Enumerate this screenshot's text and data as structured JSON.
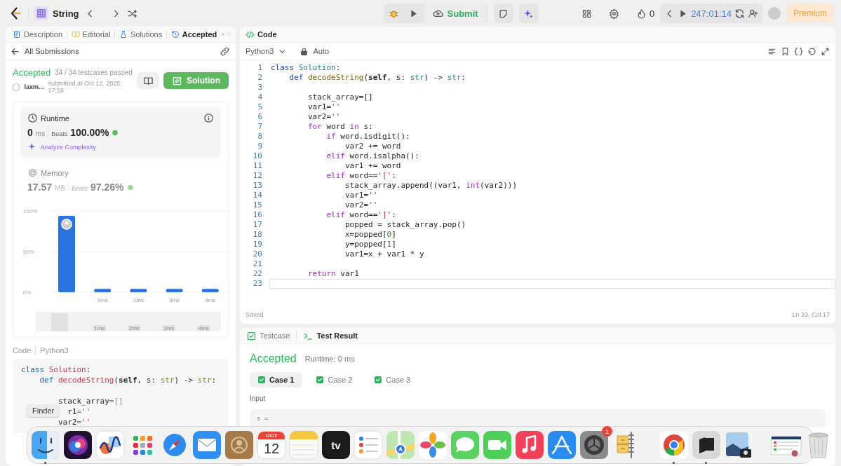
{
  "top_bar": {
    "problem_list": "String",
    "submit": "Submit",
    "streak": "0",
    "timer": "247:01:14",
    "premium": "Premium"
  },
  "left_panel": {
    "tabs": [
      {
        "label": "Description",
        "selected": false
      },
      {
        "label": "Editorial",
        "selected": false
      },
      {
        "label": "Solutions",
        "selected": false
      },
      {
        "label": "Accepted",
        "selected": true
      }
    ],
    "back_link": "All Submissions",
    "submission": {
      "status": "Accepted",
      "passed": "34 / 34 testcases passed",
      "user": "laxm...",
      "submitted": "submitted at Oct 12, 2025 17:59",
      "solution_button": "Solution"
    },
    "stats": [
      {
        "kind": "runtime",
        "label": "Runtime",
        "value": "0",
        "unit": "ms",
        "beats_label": "Beats",
        "beats": "100.00%",
        "selected": true,
        "link": "Analyze Complexity"
      },
      {
        "kind": "memory",
        "label": "Memory",
        "value": "17.57",
        "unit": "MB",
        "beats_label": "Beats",
        "beats": "97.26%",
        "selected": false
      }
    ],
    "chart_data": {
      "type": "bar",
      "categories": [
        null,
        "1ms",
        "2ms",
        "3ms",
        "4ms"
      ],
      "values": [
        94,
        4,
        4,
        4,
        4
      ],
      "ylim": [
        0,
        100
      ],
      "yticks": [
        {
          "value": 0,
          "label": "0%"
        },
        {
          "value": 50,
          "label": "50%"
        },
        {
          "value": 100,
          "label": "100%"
        }
      ]
    },
    "navigator": {
      "labels": [
        "1ms",
        "2ms",
        "3ms",
        "4ms"
      ]
    },
    "code_label": "Code",
    "code_language": "Python3",
    "code_lines": [
      {
        "kind": "code",
        "code": "class Solution:"
      },
      {
        "kind": "code",
        "code": "    def decodeString(self, s: str) -> str:"
      },
      {
        "kind": "blank"
      },
      {
        "kind": "code",
        "code": "        stack_array=[]"
      },
      {
        "kind": "code",
        "code": "          r1=''"
      },
      {
        "kind": "code",
        "code": "        var2=''"
      }
    ]
  },
  "editor": {
    "title": "Code",
    "language": "Python3",
    "mode": "Auto",
    "lines": [
      {
        "n": "1",
        "code": "class Solution:",
        "current": false
      },
      {
        "n": "2",
        "code": "    def decodeString(self, s: str) -> str:",
        "current": false
      },
      {
        "n": "3",
        "current": false
      },
      {
        "n": "4",
        "code": "        stack_array=[]",
        "current": false
      },
      {
        "n": "5",
        "code": "        var1=''",
        "current": false
      },
      {
        "n": "6",
        "code": "        var2=''",
        "current": false
      },
      {
        "n": "7",
        "code": "        for word in s:",
        "current": false
      },
      {
        "n": "8",
        "code": "            if word.isdigit():",
        "current": false
      },
      {
        "n": "9",
        "code": "                var2 += word",
        "current": false
      },
      {
        "n": "10",
        "code": "            elif word.isalpha():",
        "current": false
      },
      {
        "n": "11",
        "code": "                var1 += word",
        "current": false
      },
      {
        "n": "12",
        "code": "            elif word=='[':",
        "current": false
      },
      {
        "n": "13",
        "code": "                stack_array.append((var1, int(var2)))",
        "current": false
      },
      {
        "n": "14",
        "code": "                var1=''",
        "current": false
      },
      {
        "n": "15",
        "code": "                var2=''",
        "current": false
      },
      {
        "n": "16",
        "code": "            elif word==']':",
        "current": false
      },
      {
        "n": "17",
        "code": "                popped = stack_array.pop()",
        "current": false
      },
      {
        "n": "18",
        "code": "                x=popped[0]",
        "current": false
      },
      {
        "n": "19",
        "code": "                y=popped[1]",
        "current": false
      },
      {
        "n": "20",
        "code": "                var1=x + var1 * y",
        "current": false
      },
      {
        "n": "21",
        "current": false
      },
      {
        "n": "22",
        "code": "        return var1",
        "current": false
      },
      {
        "n": "23",
        "current": true
      }
    ],
    "status": "Saved",
    "position": "Ln 23, Col 17"
  },
  "result_panel": {
    "tabs": [
      {
        "label": "Testcase",
        "selected": false
      },
      {
        "label": "Test Result",
        "selected": true
      }
    ],
    "status": "Accepted",
    "runtime": "Runtime: 0 ms",
    "cases": [
      {
        "label": "Case 1",
        "selected": true
      },
      {
        "label": "Case 2",
        "selected": false
      },
      {
        "label": "Case 3",
        "selected": false
      }
    ],
    "input_label": "Input",
    "input_value": "s ="
  },
  "tooltip": "Finder",
  "dock": [
    {
      "kind": "finder",
      "running": true
    },
    {
      "kind": "siri",
      "running": false
    },
    {
      "kind": "freeform",
      "running": false
    },
    {
      "kind": "launchpad",
      "running": false
    },
    {
      "kind": "safari",
      "running": false
    },
    {
      "kind": "mail",
      "running": false
    },
    {
      "kind": "contacts",
      "running": false
    },
    {
      "kind": "calendar",
      "month": "OCT",
      "day": "12",
      "running": false
    },
    {
      "kind": "notes",
      "running": false
    },
    {
      "kind": "tv",
      "label": "tv",
      "running": false
    },
    {
      "kind": "reminders",
      "running": false
    },
    {
      "kind": "maps",
      "running": false
    },
    {
      "kind": "photos",
      "running": false
    },
    {
      "kind": "messages",
      "running": false
    },
    {
      "kind": "facetime",
      "running": false
    },
    {
      "kind": "music",
      "running": false
    },
    {
      "kind": "appstore",
      "running": false
    },
    {
      "kind": "settings",
      "badge": "1",
      "running": false
    },
    {
      "kind": "archive",
      "running": false
    },
    {
      "kind": "divider"
    },
    {
      "kind": "chrome",
      "running": true
    },
    {
      "kind": "parallels",
      "running": true
    },
    {
      "kind": "preview",
      "running": false
    },
    {
      "kind": "divider"
    },
    {
      "kind": "screenshot",
      "running": false
    },
    {
      "kind": "trash",
      "running": false
    }
  ]
}
